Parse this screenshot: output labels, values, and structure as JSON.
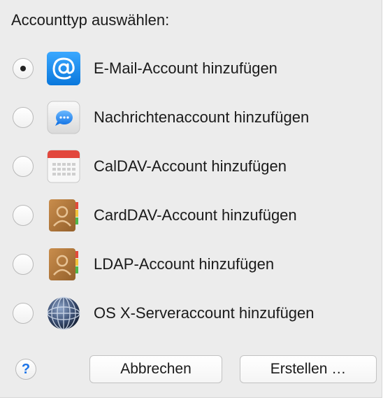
{
  "dialog": {
    "title": "Accounttyp auswählen:",
    "options": [
      {
        "label": "E-Mail-Account hinzufügen",
        "icon": "mail-at-icon",
        "selected": true
      },
      {
        "label": "Nachrichtenaccount hinzufügen",
        "icon": "messages-icon",
        "selected": false
      },
      {
        "label": "CalDAV-Account hinzufügen",
        "icon": "calendar-icon",
        "selected": false
      },
      {
        "label": "CardDAV-Account hinzufügen",
        "icon": "contacts-icon",
        "selected": false
      },
      {
        "label": "LDAP-Account hinzufügen",
        "icon": "contacts-icon",
        "selected": false
      },
      {
        "label": "OS X-Serveraccount hinzufügen",
        "icon": "globe-server-icon",
        "selected": false
      }
    ],
    "help_label": "?",
    "cancel_label": "Abbrechen",
    "create_label": "Erstellen …"
  },
  "colors": {
    "panel": "#ececec",
    "mail_blue": "#1f8ff0",
    "calendar_red": "#e2473d",
    "contacts_brown": "#b0793e",
    "help_blue": "#1a73e8"
  }
}
